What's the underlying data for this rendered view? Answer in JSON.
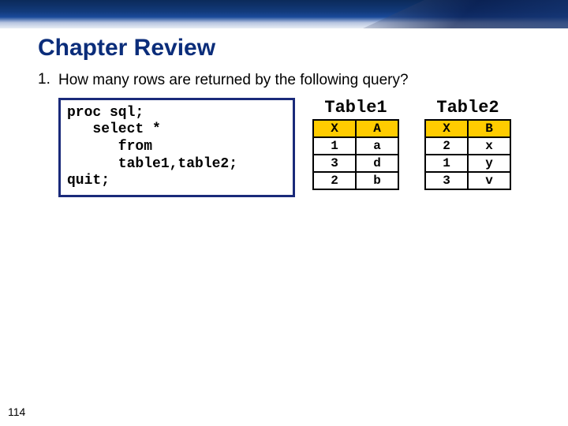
{
  "heading": "Chapter Review",
  "question": {
    "number": "1.",
    "text": "How many rows are returned by the following query?"
  },
  "code": "proc sql;\n   select *\n      from\n      table1,table2;\nquit;",
  "tables": [
    {
      "title": "Table1",
      "headers": [
        "X",
        "A"
      ],
      "rows": [
        [
          "1",
          "a"
        ],
        [
          "3",
          "d"
        ],
        [
          "2",
          "b"
        ]
      ]
    },
    {
      "title": "Table2",
      "headers": [
        "X",
        "B"
      ],
      "rows": [
        [
          "2",
          "x"
        ],
        [
          "1",
          "y"
        ],
        [
          "3",
          "v"
        ]
      ]
    }
  ],
  "page_number": "114"
}
